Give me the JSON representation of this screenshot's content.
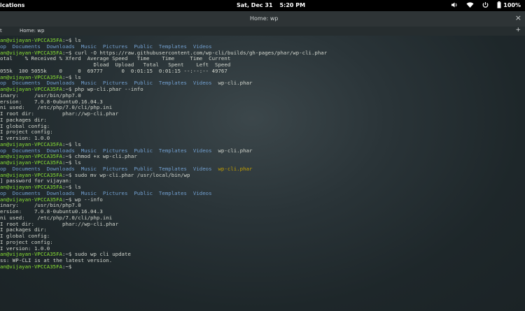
{
  "topbar": {
    "activities": "ications",
    "day": "Sat, Dec 31",
    "time": "5:20 PM",
    "battery": "100%"
  },
  "window": {
    "title": "Home: wp",
    "tabs": [
      "t",
      "Home: wp"
    ],
    "close": "×",
    "new_tab": "+"
  },
  "terminal": {
    "lines": [
      [
        [
          "g",
          "an@vijayan-VPCCA35FA"
        ],
        [
          "w",
          ":~$ ls"
        ]
      ],
      [
        [
          "b",
          "op  Documents  Downloads  Music  Pictures  Public  Templates  Videos"
        ]
      ],
      [
        [
          "g",
          "an@vijayan-VPCCA35FA"
        ],
        [
          "w",
          ":~$ curl -O https://raw.githubusercontent.com/wp-cli/builds/gh-pages/phar/wp-cli.phar"
        ]
      ],
      [
        [
          "w",
          "otal    % Received % Xferd  Average Speed   Time    Time     Time  Current"
        ]
      ],
      [
        [
          "w",
          "                              Dload  Upload   Total   Spent    Left  Speed"
        ]
      ],
      [
        [
          "w",
          "055k  100 5055k    0     0  69777      0  0:01:15  0:01:15 --:--:-- 49767"
        ]
      ],
      [
        [
          "g",
          "an@vijayan-VPCCA35FA"
        ],
        [
          "w",
          ":~$ ls"
        ]
      ],
      [
        [
          "b",
          "op  Documents  Downloads  Music  Pictures  Public  Templates  Videos  "
        ],
        [
          "w",
          "wp-cli.phar"
        ]
      ],
      [
        [
          "g",
          "an@vijayan-VPCCA35FA"
        ],
        [
          "w",
          ":~$ php wp-cli.phar --info"
        ]
      ],
      [
        [
          "w",
          "inary:     /usr/bin/php7.0"
        ]
      ],
      [
        [
          "w",
          "ersion:    7.0.8-0ubuntu0.16.04.3"
        ]
      ],
      [
        [
          "w",
          "ni used:    /etc/php/7.0/cli/php.ini"
        ]
      ],
      [
        [
          "w",
          "I root dir:         phar://wp-cli.phar"
        ]
      ],
      [
        [
          "w",
          "I packages dir:"
        ]
      ],
      [
        [
          "w",
          "I global config:"
        ]
      ],
      [
        [
          "w",
          "I project config:"
        ]
      ],
      [
        [
          "w",
          "I version: 1.0.0"
        ]
      ],
      [
        [
          "g",
          "an@vijayan-VPCCA35FA"
        ],
        [
          "w",
          ":~$ ls"
        ]
      ],
      [
        [
          "b",
          "op  Documents  Downloads  Music  Pictures  Public  Templates  Videos  "
        ],
        [
          "w",
          "wp-cli.phar"
        ]
      ],
      [
        [
          "g",
          "an@vijayan-VPCCA35FA"
        ],
        [
          "w",
          ":~$ chmod +x wp-cli.phar"
        ]
      ],
      [
        [
          "g",
          "an@vijayan-VPCCA35FA"
        ],
        [
          "w",
          ":~$ ls"
        ]
      ],
      [
        [
          "b",
          "op  Documents  Downloads  Music  Pictures  Public  Templates  Videos  "
        ],
        [
          "y",
          "wp-cli.phar"
        ]
      ],
      [
        [
          "g",
          "an@vijayan-VPCCA35FA"
        ],
        [
          "w",
          ":~$ sudo mv wp-cli.phar /usr/local/bin/wp"
        ]
      ],
      [
        [
          "w",
          "] password for vijayan:"
        ]
      ],
      [
        [
          "g",
          "an@vijayan-VPCCA35FA"
        ],
        [
          "w",
          ":~$ ls"
        ]
      ],
      [
        [
          "b",
          "op  Documents  Downloads  Music  Pictures  Public  Templates  Videos"
        ]
      ],
      [
        [
          "g",
          "an@vijayan-VPCCA35FA"
        ],
        [
          "w",
          ":~$ wp --info"
        ]
      ],
      [
        [
          "w",
          "inary:     /usr/bin/php7.0"
        ]
      ],
      [
        [
          "w",
          "ersion:    7.0.8-0ubuntu0.16.04.3"
        ]
      ],
      [
        [
          "w",
          "ni used:    /etc/php/7.0/cli/php.ini"
        ]
      ],
      [
        [
          "w",
          "I root dir:         phar://wp-cli.phar"
        ]
      ],
      [
        [
          "w",
          "I packages dir:"
        ]
      ],
      [
        [
          "w",
          "I global config:"
        ]
      ],
      [
        [
          "w",
          "I project config:"
        ]
      ],
      [
        [
          "w",
          "I version: 1.0.0"
        ]
      ],
      [
        [
          "g",
          "an@vijayan-VPCCA35FA"
        ],
        [
          "w",
          ":~$ sudo wp cli update"
        ]
      ],
      [
        [
          "w",
          "ss: WP-CLI is at the latest version."
        ]
      ],
      [
        [
          "g",
          "an@vijayan-VPCCA35FA"
        ],
        [
          "w",
          ":~$ "
        ]
      ]
    ]
  }
}
